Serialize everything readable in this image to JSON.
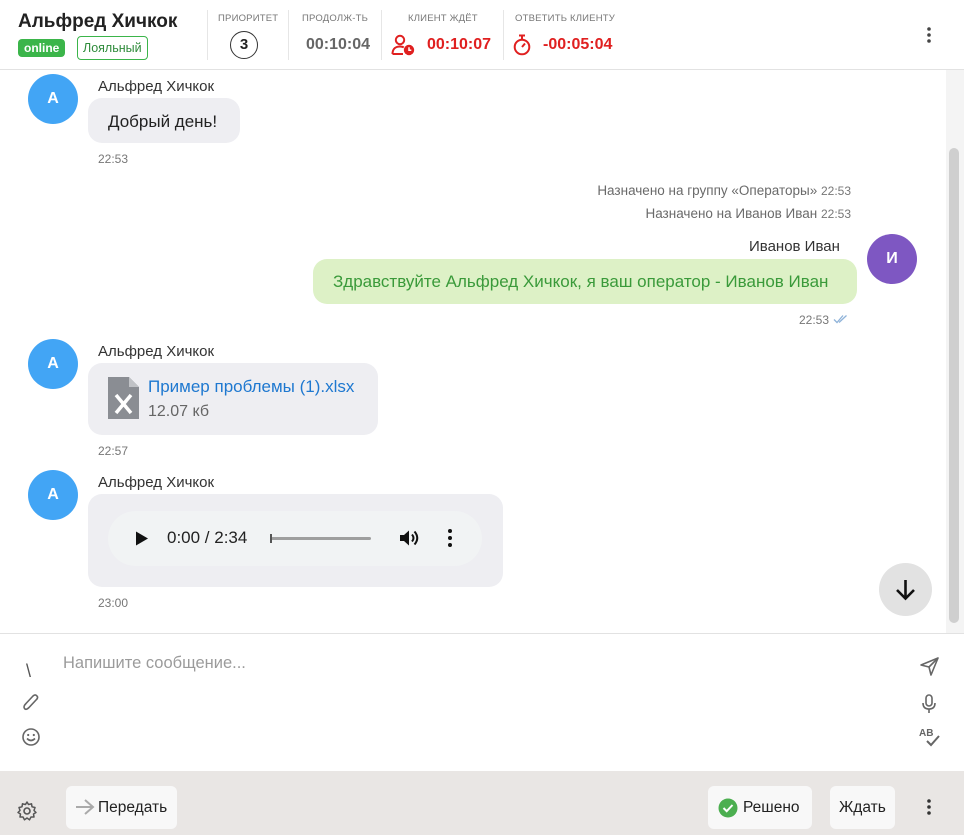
{
  "header": {
    "client_name": "Альфред Хичкок",
    "status_badge": "online",
    "loyalty_badge": "Лояльный",
    "priority_label": "ПРИОРИТЕТ",
    "priority_value": "3",
    "duration_label": "ПРОДОЛЖ-ТЬ",
    "duration_value": "00:10:04",
    "client_waits_label": "КЛИЕНТ ЖДЁТ",
    "client_waits_value": "00:10:07",
    "reply_label": "ОТВЕТИТЬ КЛИЕНТУ",
    "reply_value": "-00:05:04",
    "icons": [
      "user-clock-icon",
      "stopwatch-icon",
      "more-vertical-icon"
    ],
    "colors": {
      "online": "#3bb54a",
      "alert": "#e02020"
    }
  },
  "messages": {
    "m1": {
      "avatar": "А",
      "sender": "Альфред Хичкок",
      "text": "Добрый день!",
      "time": "22:53"
    },
    "system": [
      {
        "text": "Назначено на группу «Операторы»",
        "time": "22:53"
      },
      {
        "text": "Назначено на Иванов Иван",
        "time": "22:53"
      }
    ],
    "m2": {
      "avatar": "И",
      "sender": "Иванов Иван",
      "text": "Здравствуйте Альфред Хичкок, я ваш оператор - Иванов Иван",
      "time": "22:53"
    },
    "m3": {
      "avatar": "А",
      "sender": "Альфред Хичкок",
      "file_name": "Пример проблемы (1).xlsx",
      "file_size": "12.07 кб",
      "time": "22:57"
    },
    "m4": {
      "avatar": "А",
      "sender": "Альфред Хичкок",
      "audio_time": "0:00 / 2:34",
      "time": "23:00"
    }
  },
  "composer": {
    "placeholder": "Напишите сообщение...",
    "slash": "\\"
  },
  "footer": {
    "transfer_label": "Передать",
    "resolved_label": "Решено",
    "wait_label": "Ждать"
  }
}
